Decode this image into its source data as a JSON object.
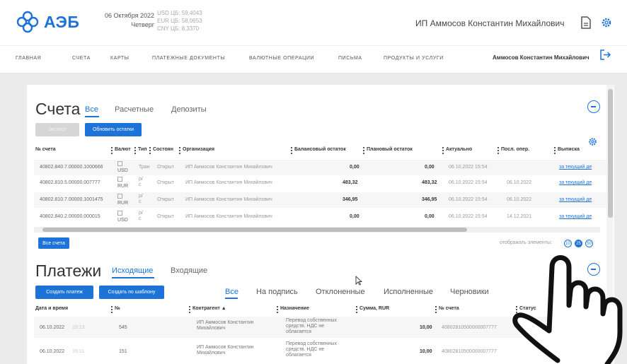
{
  "header": {
    "logo_text": "АЭБ",
    "date": "06 Октября 2022",
    "weekday": "Четверг",
    "rates": [
      "USD ЦБ: 59,4043",
      "EUR ЦБ: 58,0653",
      "CNY ЦБ: 8,3370"
    ],
    "user_name": "ИП Аммосов Константин Михайлович",
    "icons": [
      "document-icon",
      "settings-icon"
    ]
  },
  "nav": {
    "items": [
      "ГЛАВНАЯ",
      "СЧЕТА",
      "КАРТЫ",
      "ПЛАТЕЖНЫЕ ДОКУМЕНТЫ",
      "ВАЛЮТНЫЕ ОПЕРАЦИИ",
      "ПИСЬМА",
      "ПРОДУКТЫ И УСЛУГИ"
    ],
    "user": "Аммосов Константин Михайлович",
    "logout_icon": "logout-icon"
  },
  "accounts": {
    "title": "Счета",
    "tabs": [
      "Все",
      "Расчетные",
      "Депозиты"
    ],
    "active_tab": "Все",
    "buttons": {
      "disabled": "Экспорт",
      "refresh": "Обновить остатки",
      "all": "Все счета"
    },
    "columns": [
      "№ счета",
      "Валют",
      "Тип",
      "Состоян",
      "Организация",
      "Балансовый остаток",
      "Плановый остаток",
      "Актуально",
      "Посл. опер.",
      "Выписка"
    ],
    "rows": [
      {
        "number": "40802.840.7.00000.1000666",
        "currency": "USD",
        "type": "Тран",
        "status": "Открыт",
        "org": "ИП Аммосов Константин Михайлович",
        "balance": "0,00",
        "planned": "0,00",
        "actual": "06.10.2022 15:54",
        "last_op": "",
        "statement": "за текущий де"
      },
      {
        "number": "40802.810.5.00000.007777",
        "currency": "RUR",
        "type": "р/с",
        "status": "Открыт",
        "org": "ИП Аммосов Константин Михайлович",
        "balance": "483,32",
        "planned": "483,32",
        "actual": "06.10.2022 15:54",
        "last_op": "06.10.2022",
        "statement": "за текущий де"
      },
      {
        "number": "40802.810.7.00000.1001475",
        "currency": "RUR",
        "type": "р/с",
        "status": "Открыт",
        "org": "ИП Аммосов Константин Михайлович",
        "balance": "346,95",
        "planned": "346,95",
        "actual": "06.10.2022 15:54",
        "last_op": "06.10.2022",
        "statement": "за текущий де"
      },
      {
        "number": "40802.840.2.00000.000015",
        "currency": "USD",
        "type": "р/с",
        "status": "Открыт",
        "org": "ИП Аммосов Константин Михайлович",
        "balance": "0,00",
        "planned": "0,00",
        "actual": "06.10.2022 15:54",
        "last_op": "14.12.2021",
        "statement": "за текущий де"
      }
    ],
    "pager_label": "отображать элементы:",
    "pages": [
      "10",
      "25",
      "50"
    ],
    "active_page": "25"
  },
  "payments": {
    "title": "Платежи",
    "tabs": [
      "Исходящие",
      "Входящие"
    ],
    "active_tab": "Исходящие",
    "buttons": {
      "create": "Создать платеж",
      "template": "Создать по шаблону"
    },
    "filters": [
      "Все",
      "На подпись",
      "Отклоненные",
      "Исполненные",
      "Черновики"
    ],
    "active_filter": "Все",
    "columns": [
      "Дата и время",
      "№",
      "Контрагент ▲",
      "Назначение",
      "Сумма, RUR",
      "№ счета",
      "Статус"
    ],
    "rows": [
      {
        "date": "06.10.2022",
        "time": "15:13",
        "number": "545",
        "counterparty": "ИП Аммосов Константин\nМихайлович",
        "purpose": "Перевод собственных\nсредств. НДС не\nоблагается",
        "amount": "10,00",
        "account": "40802810500000007777"
      },
      {
        "date": "06.10.2022",
        "time": "15:11",
        "number": "151",
        "counterparty": "ИП Аммосов Константин\nМихайлович",
        "purpose": "Перевод собственных\nсредств. НДС не\nоблагается",
        "amount": "10,00",
        "account": "40802810500000007777"
      }
    ]
  }
}
